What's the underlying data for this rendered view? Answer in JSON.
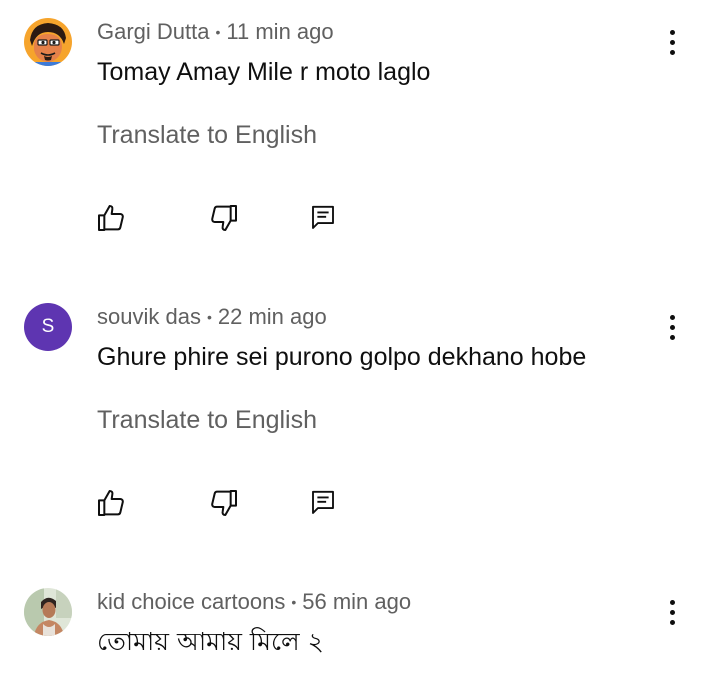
{
  "comments": [
    {
      "author": "Gargi Dutta",
      "time": "11 min ago",
      "separator": "•",
      "text": "Tomay Amay Mile r moto laglo",
      "translate_label": "Translate to English",
      "avatar_type": "illustrated-face"
    },
    {
      "author": "souvik das",
      "time": "22 min ago",
      "separator": "•",
      "text": "Ghure phire sei purono golpo dekhano hobe",
      "translate_label": "Translate to English",
      "avatar_letter": "S",
      "avatar_color": "#5e35b1"
    },
    {
      "author": "kid choice cartoons",
      "time": "56 min ago",
      "separator": "•",
      "text": "তোমায় আমায় মিলে ২",
      "avatar_type": "photo"
    }
  ],
  "icons": {
    "like": "thumb-up-icon",
    "dislike": "thumb-down-icon",
    "reply": "reply-icon",
    "more": "more-vert-icon"
  },
  "colors": {
    "text_primary": "#0f0f0f",
    "text_secondary": "#606060"
  }
}
